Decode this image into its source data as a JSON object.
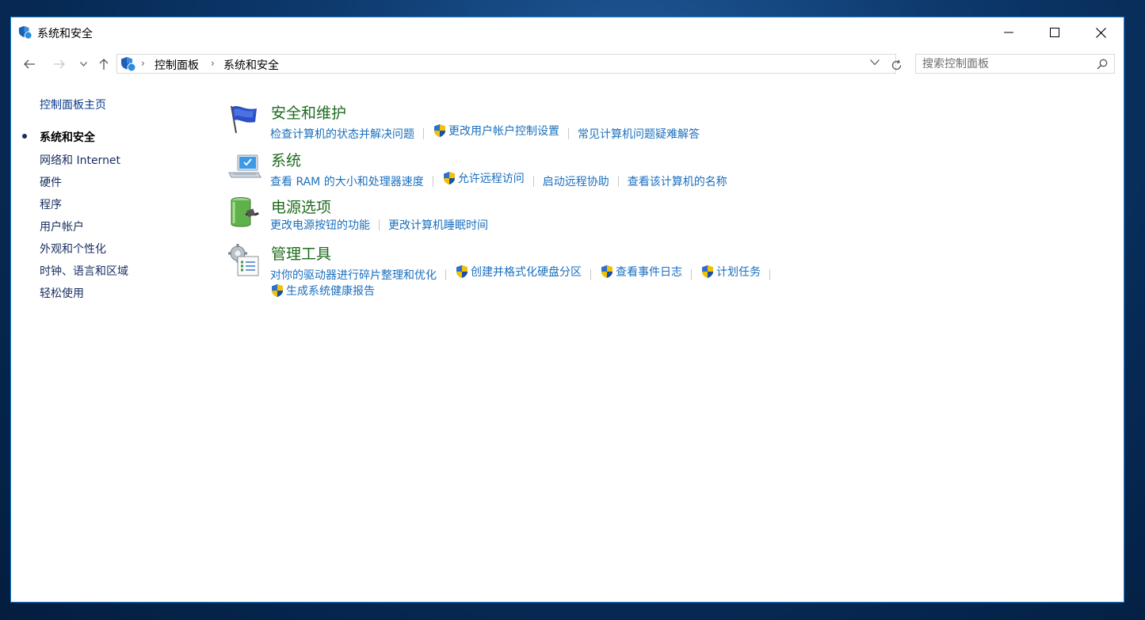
{
  "window": {
    "title": "系统和安全"
  },
  "window_controls": {
    "minimize": "minimize-icon",
    "maximize": "maximize-icon",
    "close": "close-icon"
  },
  "address": {
    "breadcrumbs": [
      "控制面板",
      "系统和安全"
    ],
    "search_placeholder": "搜索控制面板"
  },
  "sidebar": {
    "home": "控制面板主页",
    "items": [
      {
        "label": "系统和安全",
        "active": true
      },
      {
        "label": "网络和 Internet"
      },
      {
        "label": "硬件"
      },
      {
        "label": "程序"
      },
      {
        "label": "用户帐户"
      },
      {
        "label": "外观和个性化"
      },
      {
        "label": "时钟、语言和区域"
      },
      {
        "label": "轻松使用"
      }
    ]
  },
  "sections": [
    {
      "title": "安全和维护",
      "icon": "flag-icon",
      "links": [
        {
          "label": "检查计算机的状态并解决问题"
        },
        {
          "label": "更改用户帐户控制设置",
          "shield": true
        },
        {
          "label": "常见计算机问题疑难解答"
        }
      ]
    },
    {
      "title": "系统",
      "icon": "computer-icon",
      "links": [
        {
          "label": "查看 RAM 的大小和处理器速度"
        },
        {
          "label": "允许远程访问",
          "shield": true
        },
        {
          "label": "启动远程协助"
        },
        {
          "label": "查看该计算机的名称"
        }
      ]
    },
    {
      "title": "电源选项",
      "icon": "battery-icon",
      "links": [
        {
          "label": "更改电源按钮的功能"
        },
        {
          "label": "更改计算机睡眠时间"
        }
      ]
    },
    {
      "title": "管理工具",
      "icon": "admin-tools-icon",
      "links": [
        {
          "label": "对你的驱动器进行碎片整理和优化"
        },
        {
          "label": "创建并格式化硬盘分区",
          "shield": true
        },
        {
          "label": "查看事件日志",
          "shield": true
        },
        {
          "label": "计划任务",
          "shield": true
        }
      ],
      "links2": [
        {
          "label": "生成系统健康报告",
          "shield": true
        }
      ]
    }
  ],
  "colors": {
    "link": "#1a6fbe",
    "section_title": "#1e6b1e",
    "window_border": "#1883d7"
  }
}
